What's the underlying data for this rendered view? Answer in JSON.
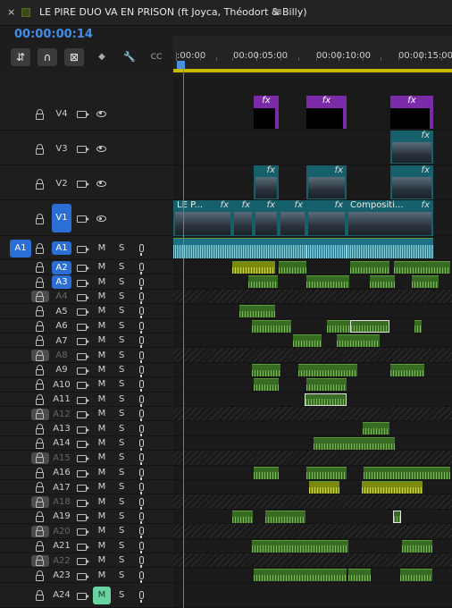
{
  "panel": {
    "close_glyph": "×",
    "sequence_name": "LE PIRE DUO VA EN PRISON (ft Joyca, Théodort & Billy)",
    "menu_glyph": "≡",
    "timecode": "00:00:00:14"
  },
  "toolbar": {
    "tools": [
      {
        "icon": "insert-overwrite-icon",
        "glyph": "⇵"
      },
      {
        "icon": "snap-magnet-icon",
        "glyph": "∩"
      },
      {
        "icon": "linked-selection-icon",
        "glyph": "⊠"
      },
      {
        "icon": "add-marker-icon",
        "glyph": "◆"
      },
      {
        "icon": "wrench-settings-icon",
        "glyph": "🔧"
      },
      {
        "icon": "captions-icon",
        "glyph": "CC"
      }
    ]
  },
  "ruler": {
    "labels": [
      ":00:00",
      "00:00:05:00",
      "00:00:10:00",
      "00:00:15:00"
    ],
    "playhead_seconds": 0.58
  },
  "tracks": {
    "video": [
      {
        "name": "V4",
        "targeted": false
      },
      {
        "name": "V3",
        "targeted": false
      },
      {
        "name": "V2",
        "targeted": false
      },
      {
        "name": "V1",
        "targeted": true
      }
    ],
    "audio": [
      {
        "name": "A1",
        "source": "A1",
        "targeted": true,
        "locked": false,
        "mute_active": false
      },
      {
        "name": "A2",
        "targeted": true,
        "locked": false
      },
      {
        "name": "A3",
        "targeted": true,
        "locked": false
      },
      {
        "name": "A4",
        "locked": true
      },
      {
        "name": "A5",
        "locked": false
      },
      {
        "name": "A6",
        "locked": false
      },
      {
        "name": "A7",
        "locked": false
      },
      {
        "name": "A8",
        "locked": true
      },
      {
        "name": "A9",
        "locked": false
      },
      {
        "name": "A10",
        "locked": false
      },
      {
        "name": "A11",
        "locked": false
      },
      {
        "name": "A12",
        "locked": true
      },
      {
        "name": "A13",
        "locked": false
      },
      {
        "name": "A14",
        "locked": false
      },
      {
        "name": "A15",
        "locked": true
      },
      {
        "name": "A16",
        "locked": false
      },
      {
        "name": "A17",
        "locked": false
      },
      {
        "name": "A18",
        "locked": true
      },
      {
        "name": "A19",
        "locked": false
      },
      {
        "name": "A20",
        "locked": true
      },
      {
        "name": "A21",
        "locked": false
      },
      {
        "name": "A22",
        "locked": true
      },
      {
        "name": "A23",
        "locked": false
      },
      {
        "name": "A24",
        "locked": false,
        "mute_active": true
      }
    ],
    "mute_label": "M",
    "solo_label": "S"
  },
  "clips": {
    "fx_label": "fx",
    "v1_titles": [
      "LE P...",
      "Compositi..."
    ]
  },
  "colors": {
    "accent_blue": "#2b6fd4",
    "timecode_blue": "#3f8ee8",
    "fx_purple": "#7b2ba8",
    "video_teal": "#16606c",
    "audio_green": "#386c22",
    "audio_a1_cyan": "#1e7185",
    "mute_active": "#67d3a1",
    "inout_yellow": "#c8b900"
  }
}
